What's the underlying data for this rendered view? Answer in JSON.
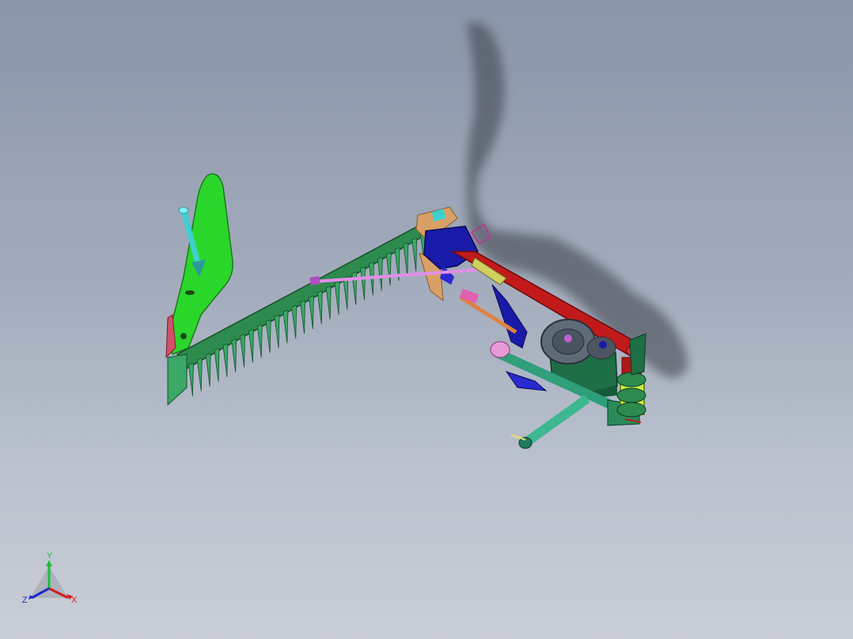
{
  "viewport": {
    "background_top": "#8996a8",
    "background_bottom": "#c9cdd6"
  },
  "model": {
    "parts": [
      "shield-plate",
      "cutter-bar",
      "knife-section",
      "connecting-rod",
      "frame-bracket",
      "lift-arm",
      "gearbox",
      "pulley",
      "drawbar",
      "hitch-plate"
    ],
    "colors": {
      "shield_green": "#2bd62b",
      "cutter_green": "#2e8b4e",
      "knife_green": "#3aa866",
      "rod_pink": "#e28ee8",
      "bracket_blue": "#1a1aa8",
      "arm_red": "#c21a1a",
      "box_green": "#1e6e46",
      "pulley_gray": "#5e6b78",
      "drawbar_teal": "#2f9e7a",
      "hitch_yellow": "#c8f040",
      "spring_cyan": "#3ecfcf",
      "bracket_tan": "#d9a066"
    }
  },
  "triad": {
    "x_label": "X",
    "y_label": "Y",
    "z_label": "Z",
    "x_color": "#d21b1b",
    "y_color": "#1bbf3b",
    "z_color": "#1b2ad2"
  }
}
